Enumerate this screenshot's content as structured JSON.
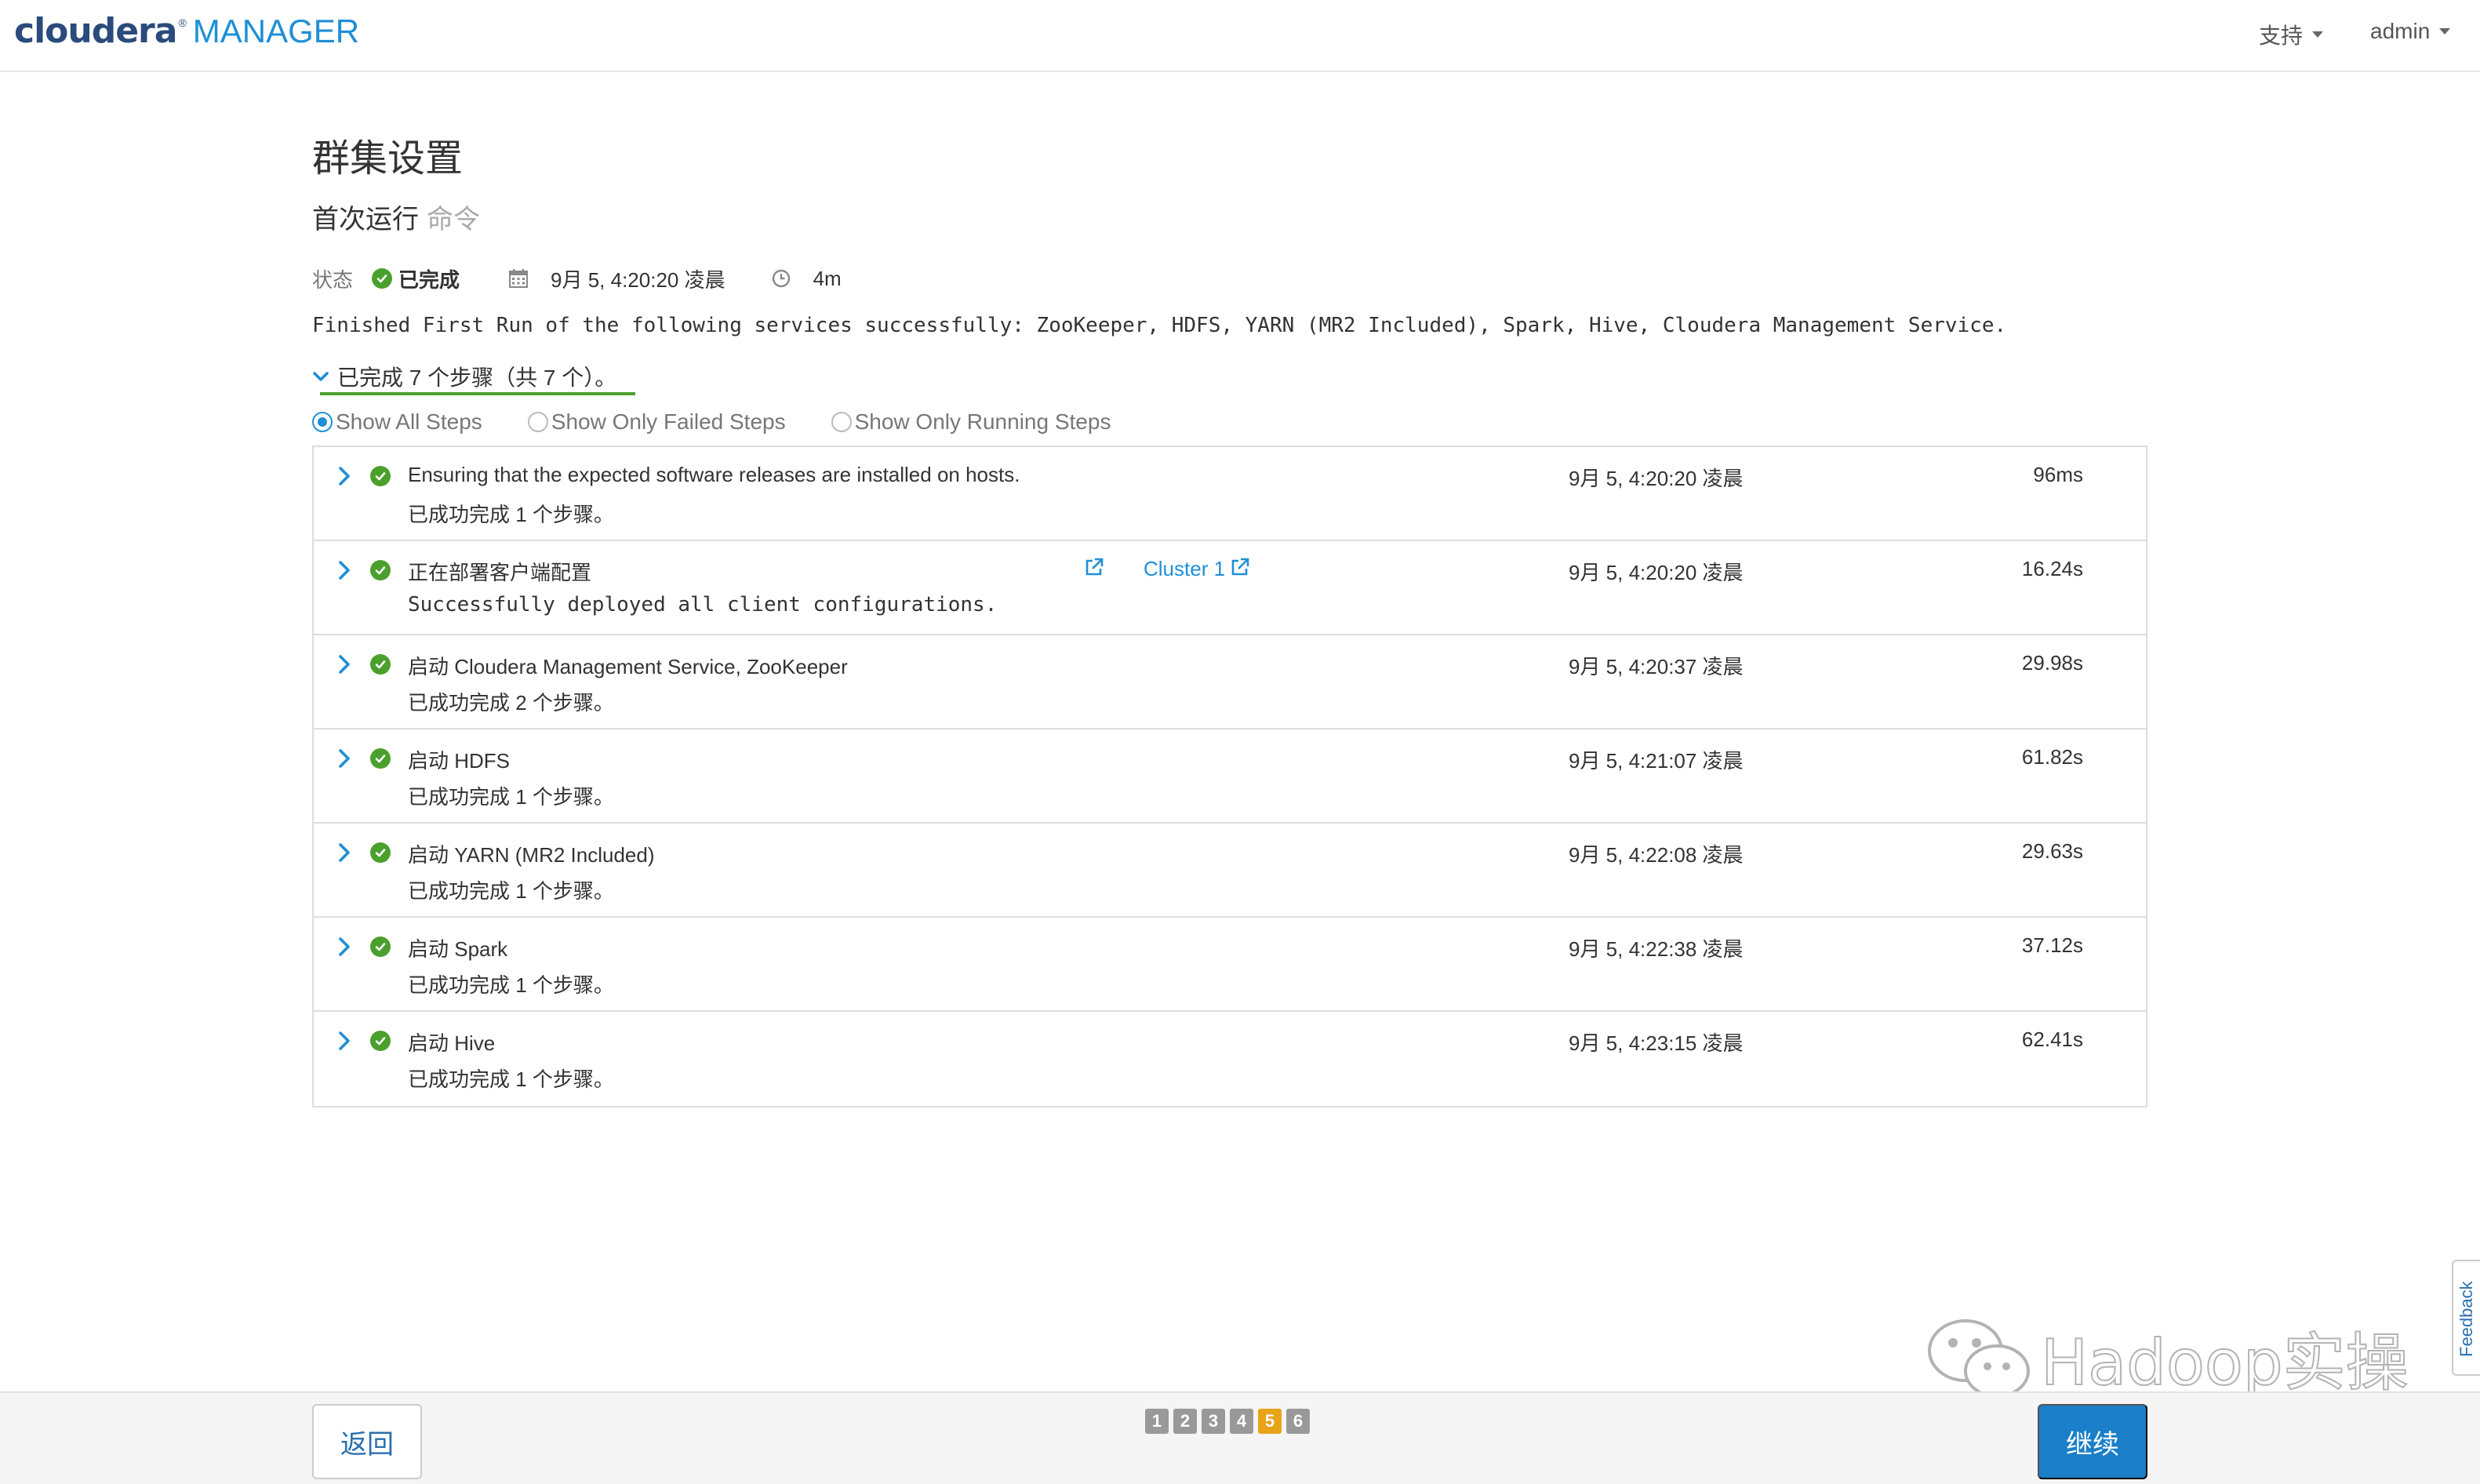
{
  "header": {
    "logo_main": "cloudera",
    "logo_reg": "®",
    "logo_sub": "MANAGER",
    "support_menu": "支持",
    "user_menu": "admin"
  },
  "page": {
    "title": "群集设置",
    "subtitle": "首次运行",
    "subtitle_muted": "命令",
    "status_label": "状态",
    "status_value": "已完成",
    "status_date": "9月 5, 4:20:20 凌晨",
    "status_duration": "4m",
    "summary": "Finished First Run of the following services successfully: ZooKeeper, HDFS, YARN (MR2 Included), Spark, Hive, Cloudera Management Service.",
    "completed_steps": "已完成 7 个步骤（共 7 个）。"
  },
  "filters": {
    "all": "Show All Steps",
    "failed": "Show Only Failed Steps",
    "running": "Show Only Running Steps",
    "selected": "all"
  },
  "steps": [
    {
      "title": "Ensuring that the expected software releases are installed on hosts.",
      "sub": "已成功完成  1  个步骤。",
      "time": "9月 5, 4:20:20 凌晨",
      "duration": "96ms"
    },
    {
      "title": "正在部署客户端配置",
      "sub": "Successfully deployed all client configurations.",
      "link": "Cluster 1",
      "time": "9月 5, 4:20:20 凌晨",
      "duration": "16.24s"
    },
    {
      "title": "启动 Cloudera Management Service, ZooKeeper",
      "sub": "已成功完成  2  个步骤。",
      "time": "9月 5, 4:20:37 凌晨",
      "duration": "29.98s"
    },
    {
      "title": "启动 HDFS",
      "sub": "已成功完成  1  个步骤。",
      "time": "9月 5, 4:21:07 凌晨",
      "duration": "61.82s"
    },
    {
      "title": "启动 YARN (MR2 Included)",
      "sub": "已成功完成  1  个步骤。",
      "time": "9月 5, 4:22:08 凌晨",
      "duration": "29.63s"
    },
    {
      "title": "启动 Spark",
      "sub": "已成功完成  1  个步骤。",
      "time": "9月 5, 4:22:38 凌晨",
      "duration": "37.12s"
    },
    {
      "title": "启动 Hive",
      "sub": "已成功完成  1  个步骤。",
      "time": "9月 5, 4:23:15 凌晨",
      "duration": "62.41s"
    }
  ],
  "feedback": "Feedback",
  "watermark": "Hadoop实操",
  "footer": {
    "back": "返回",
    "continue": "继续",
    "pages": [
      "1",
      "2",
      "3",
      "4",
      "5",
      "6"
    ],
    "current_page": "5"
  },
  "colors": {
    "brand": "#2a4b7c",
    "accent": "#1f8fd6",
    "success": "#4aa02c",
    "active_page": "#e8a317",
    "primary_button": "#1a7fc8"
  }
}
